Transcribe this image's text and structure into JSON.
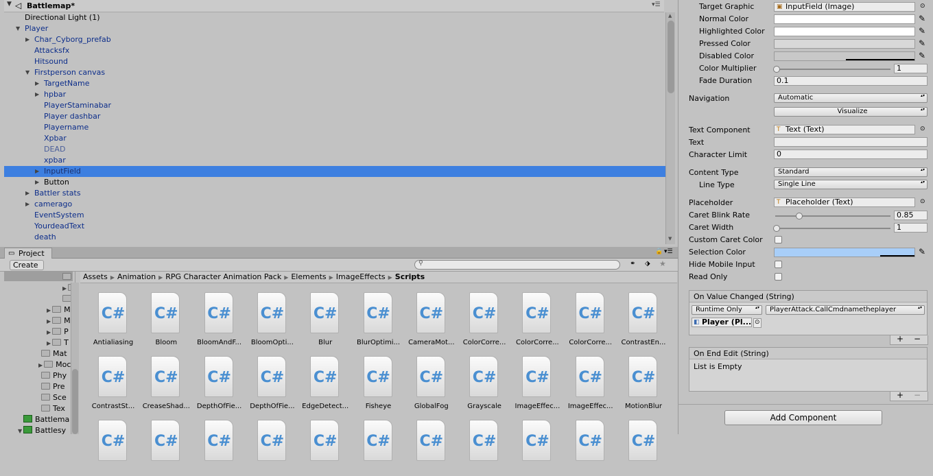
{
  "hierarchy": {
    "scene_title": "Battlemap*",
    "items": [
      {
        "label": "Directional Light (1)",
        "depth": 0,
        "fold": "",
        "style": "black"
      },
      {
        "label": "Player",
        "depth": 0,
        "fold": "open",
        "style": "blue"
      },
      {
        "label": "Char_Cyborg_prefab",
        "depth": 1,
        "fold": "closed",
        "style": "blue"
      },
      {
        "label": "Attacksfx",
        "depth": 1,
        "fold": "",
        "style": "blue"
      },
      {
        "label": "Hitsound",
        "depth": 1,
        "fold": "",
        "style": "blue"
      },
      {
        "label": "Firstperson canvas",
        "depth": 1,
        "fold": "open",
        "style": "blue"
      },
      {
        "label": "TargetName",
        "depth": 2,
        "fold": "closed",
        "style": "blue"
      },
      {
        "label": "hpbar",
        "depth": 2,
        "fold": "closed",
        "style": "blue"
      },
      {
        "label": "PlayerStaminabar",
        "depth": 2,
        "fold": "",
        "style": "blue"
      },
      {
        "label": "Player dashbar",
        "depth": 2,
        "fold": "",
        "style": "blue"
      },
      {
        "label": "Playername",
        "depth": 2,
        "fold": "",
        "style": "blue"
      },
      {
        "label": "Xpbar",
        "depth": 2,
        "fold": "",
        "style": "blue"
      },
      {
        "label": "DEAD",
        "depth": 2,
        "fold": "",
        "style": "gray"
      },
      {
        "label": "xpbar",
        "depth": 2,
        "fold": "",
        "style": "blue"
      },
      {
        "label": "InputField",
        "depth": 2,
        "fold": "closed",
        "style": "selected"
      },
      {
        "label": "Button",
        "depth": 2,
        "fold": "closed",
        "style": "black"
      },
      {
        "label": "Battler stats",
        "depth": 1,
        "fold": "closed",
        "style": "blue"
      },
      {
        "label": "camerago",
        "depth": 1,
        "fold": "closed",
        "style": "blue"
      },
      {
        "label": "EventSystem",
        "depth": 1,
        "fold": "",
        "style": "blue"
      },
      {
        "label": "YourdeadText",
        "depth": 1,
        "fold": "",
        "style": "blue"
      },
      {
        "label": "death",
        "depth": 1,
        "fold": "",
        "style": "blue"
      }
    ]
  },
  "project": {
    "tab_label": "Project",
    "create_label": "Create",
    "breadcrumb": [
      "Assets",
      "Animation",
      "RPG Character Animation Pack",
      "Elements",
      "ImageEffects",
      "Scripts"
    ],
    "tree": [
      {
        "label": "",
        "kind": "folder",
        "fold": ""
      },
      {
        "label": "",
        "kind": "folder",
        "fold": "closed"
      },
      {
        "label": "",
        "kind": "folder",
        "fold": ""
      },
      {
        "label": "M",
        "kind": "folder",
        "fold": "closed"
      },
      {
        "label": "M",
        "kind": "folder",
        "fold": "closed"
      },
      {
        "label": "P",
        "kind": "folder",
        "fold": "closed"
      },
      {
        "label": "T",
        "kind": "folder",
        "fold": "closed"
      },
      {
        "label": "Mat",
        "kind": "folder",
        "fold": ""
      },
      {
        "label": "Moc",
        "kind": "folder",
        "fold": "closed"
      },
      {
        "label": "Phy",
        "kind": "folder",
        "fold": ""
      },
      {
        "label": "Pre",
        "kind": "folder",
        "fold": ""
      },
      {
        "label": "Sce",
        "kind": "folder",
        "fold": ""
      },
      {
        "label": "Tex",
        "kind": "folder",
        "fold": ""
      },
      {
        "label": "Battlema",
        "kind": "scene",
        "fold": ""
      },
      {
        "label": "Battlesy",
        "kind": "scene",
        "fold": "open"
      }
    ],
    "row1": [
      "Antialiasing",
      "Bloom",
      "BloomAndF...",
      "BloomOpti...",
      "Blur",
      "BlurOptimi...",
      "CameraMot...",
      "ColorCorre...",
      "ColorCorre...",
      "ColorCorre...",
      "ContrastEn..."
    ],
    "row2": [
      "ContrastSt...",
      "CreaseShad...",
      "DepthOfFie...",
      "DepthOfFie...",
      "EdgeDetect...",
      "Fisheye",
      "GlobalFog",
      "Grayscale",
      "ImageEffec...",
      "ImageEffec...",
      "MotionBlur"
    ],
    "script_glyph": "C#"
  },
  "inspector": {
    "target_graphic_label": "Target Graphic",
    "target_graphic_value": "InputField (Image)",
    "normal_color_label": "Normal Color",
    "highlighted_color_label": "Highlighted Color",
    "pressed_color_label": "Pressed Color",
    "disabled_color_label": "Disabled Color",
    "color_multiplier_label": "Color Multiplier",
    "color_multiplier_value": "1",
    "fade_duration_label": "Fade Duration",
    "fade_duration_value": "0.1",
    "navigation_label": "Navigation",
    "navigation_value": "Automatic",
    "visualize_label": "Visualize",
    "text_component_label": "Text Component",
    "text_component_value": "Text (Text)",
    "text_label": "Text",
    "text_value": "",
    "char_limit_label": "Character Limit",
    "char_limit_value": "0",
    "content_type_label": "Content Type",
    "content_type_value": "Standard",
    "line_type_label": "Line Type",
    "line_type_value": "Single Line",
    "placeholder_label": "Placeholder",
    "placeholder_value": "Placeholder (Text)",
    "caret_blink_label": "Caret Blink Rate",
    "caret_blink_value": "0.85",
    "caret_width_label": "Caret Width",
    "caret_width_value": "1",
    "custom_caret_label": "Custom Caret Color",
    "selection_color_label": "Selection Color",
    "hide_mobile_label": "Hide Mobile Input",
    "read_only_label": "Read Only",
    "on_value_changed_label": "On Value Changed (String)",
    "runtime_value": "Runtime Only",
    "function_value": "PlayerAttack.CallCmdnametheplayer",
    "object_value": "Player (Pl...",
    "on_end_edit_label": "On End Edit (String)",
    "list_empty_label": "List is Empty",
    "plus": "+",
    "minus": "−",
    "add_component_label": "Add Component"
  },
  "colors": {
    "selection_highlight": "#3d7fe0",
    "selection_color_swatch": "#a8cef8",
    "cs_blue": "#4a8fd1"
  }
}
